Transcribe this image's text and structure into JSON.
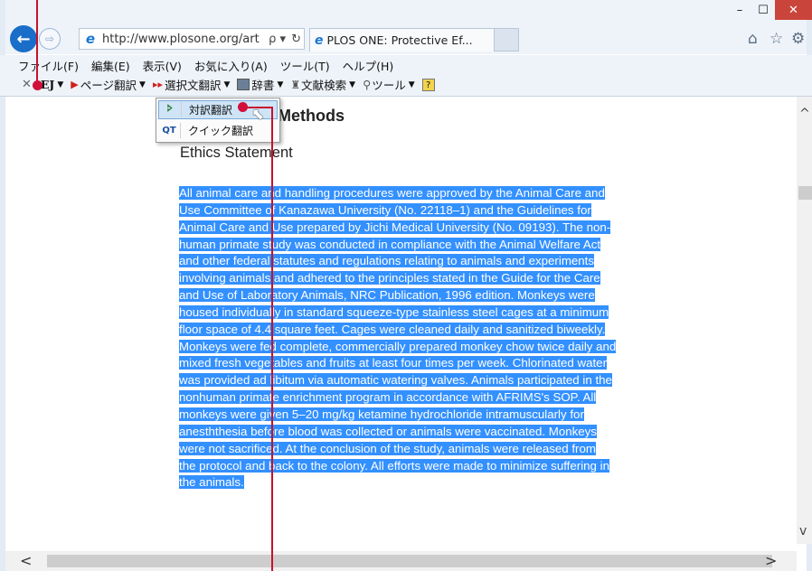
{
  "window": {
    "minimize_glyph": "–",
    "maximize_glyph": "☐",
    "close_glyph": "✕"
  },
  "nav": {
    "back_glyph": "←",
    "forward_glyph": "⇨",
    "address_url": "http://www.plosone.org/art",
    "address_search_glyph": "ρ ▾",
    "address_refresh_glyph": "↻"
  },
  "tabs": [
    {
      "label": "PLOS ONE: Protective Ef...",
      "close_glyph": "×"
    }
  ],
  "menubar": [
    "ファイル(F)",
    "編集(E)",
    "表示(V)",
    "お気に入り(A)",
    "ツール(T)",
    "ヘルプ(H)"
  ],
  "toolbar": {
    "close_glyph": "✕",
    "ej": "EJ",
    "page_translate": "ページ翻訳",
    "selection_translate": "選択文翻訳",
    "dictionary": "辞書",
    "literature_search": "文献検索",
    "tools": "ツール"
  },
  "popup_menu": [
    {
      "label": "対訳翻訳",
      "icon": "translation-pair-icon"
    },
    {
      "label": "クイック翻訳",
      "icon": "quick-translate-icon"
    }
  ],
  "article": {
    "section_title": "Methods",
    "subsection_title": "Ethics Statement",
    "paragraph_lines": [
      "All animal care and handling procedures were approved by the Animal Care and",
      "Use Committee of Kanazawa University (No. 22118–1) and the Guidelines for",
      "Animal Care and Use prepared by Jichi Medical University (No. 09193). The non-",
      "human primate study was conducted in compliance with the Animal Welfare Act",
      "and other federal statutes and regulations relating to animals and experiments",
      "involving animals and adhered to the principles stated in the Guide for the Care",
      "and Use of Laboratory Animals, NRC Publication, 1996 edition. Monkeys were",
      "housed individually in standard squeeze-type stainless steel cages at a minimum",
      "floor space of 4.4 square feet. Cages were cleaned daily and sanitized biweekly.",
      "Monkeys were fed complete, commercially prepared monkey chow twice daily and",
      "mixed fresh vegetables and fruits at least four times per week. Chlorinated water",
      "was provided ad libitum via automatic watering valves. Animals participated in the",
      "nonhuman primate enrichment program in accordance with AFRIMS's SOP. All",
      "monkeys were given 5–20 mg/kg ketamine hydrochloride intramuscularly for",
      "anesththesia before blood was collected or animals were vaccinated. Monkeys",
      "were not sacrificed. At the conclusion of the study, animals were released from",
      "the protocol and back to the colony. All efforts were made to minimize suffering in",
      "the animals."
    ]
  },
  "colors": {
    "selection": "#3390ff",
    "annotation": "#c8102e",
    "back_button": "#1a6dc9"
  },
  "scrollbar": {
    "up": "^",
    "down": "v",
    "left": "<",
    "right": ">"
  }
}
